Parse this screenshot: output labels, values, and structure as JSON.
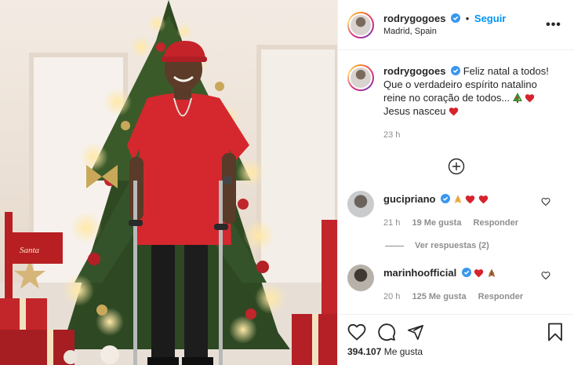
{
  "post": {
    "username": "rodrygogoes",
    "follow_label": "Seguir",
    "location": "Madrid, Spain",
    "more_label": "•••"
  },
  "caption": {
    "username": "rodrygogoes",
    "text_line1": "Feliz natal a todos!",
    "text_line2": "Que o verdadeiro espírito natalino",
    "text_line3": "reine no coração de todos...",
    "text_line4": "Jesus nasceu",
    "time": "23 h"
  },
  "comments": [
    {
      "username": "gucipriano",
      "time": "21 h",
      "likes": "19 Me gusta",
      "reply_label": "Responder",
      "view_replies": "Ver respuestas (2)"
    },
    {
      "username": "marinhoofficial",
      "time": "20 h",
      "likes": "125 Me gusta",
      "reply_label": "Responder"
    }
  ],
  "footer": {
    "likes_count": "394.107",
    "likes_label": "Me gusta"
  },
  "photo": {
    "tag_text": "Santa"
  },
  "colors": {
    "follow_blue": "#0095f6",
    "heart_red": "#ed4956",
    "muted": "#8e8e8e"
  },
  "icons": [
    "verified-icon",
    "more-icon",
    "load-more-icon",
    "heart-icon",
    "comment-icon",
    "share-icon",
    "save-icon",
    "tree-emoji",
    "praying-hands-emoji"
  ]
}
